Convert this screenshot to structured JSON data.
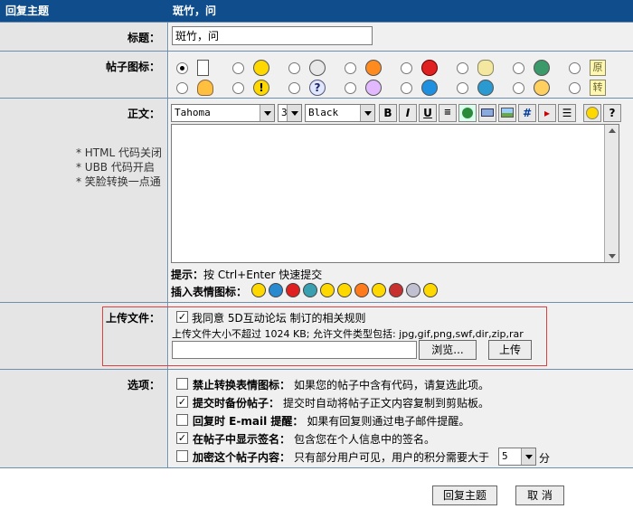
{
  "header": {
    "left": "回复主题",
    "right": "斑竹，问"
  },
  "title_row": {
    "label": "标题：",
    "value": "斑竹，问"
  },
  "post_icon": {
    "label": "帖子图标：",
    "selected_index": 0
  },
  "body_row": {
    "label": "正文：",
    "notes": [
      "* HTML 代码关闭",
      "* UBB 代码开启",
      "* 笑脸转换一点通"
    ],
    "font": "Tahoma",
    "size": "3",
    "color": "Black",
    "hint_label": "提示：",
    "hint_text": "按 Ctrl+Enter 快速提交",
    "insert_label": "插入表情图标："
  },
  "upload": {
    "label": "上传文件：",
    "agree_text": "我同意 5D互动论坛 制订的相关规则",
    "limit_text": "上传文件大小不超过 1024 KB; 允许文件类型包括: jpg,gif,png,swf,dir,zip,rar",
    "browse_label": "浏览...",
    "upload_label": "上传",
    "agree_checked": true
  },
  "options": {
    "label": "选项：",
    "items": [
      {
        "bold": "禁止转换表情图标：",
        "text": "如果您的帖子中含有代码，请复选此项。",
        "checked": false
      },
      {
        "bold": "提交时备份帖子：",
        "text": "提交时自动将帖子正文内容复制到剪贴板。",
        "checked": true
      },
      {
        "bold": "回复时 E-mail 提醒：",
        "text": "如果有回复则通过电子邮件提醒。",
        "checked": false
      },
      {
        "bold": "在帖子中显示签名：",
        "text": "包含您在个人信息中的签名。",
        "checked": true
      },
      {
        "bold": "加密这个帖子内容：",
        "text": "只有部分用户可见，用户的积分需要大于",
        "checked": false
      }
    ],
    "points_value": "5",
    "points_unit": "分"
  },
  "footer": {
    "submit_label": "回复主题",
    "cancel_label": "取 消"
  },
  "icons": {
    "row1": [
      "note-icon",
      "smile-icon",
      "plain-face-icon",
      "orange-face-icon",
      "hand-stop-icon",
      "pointing-hand-icon",
      "green-face-icon",
      "yuan-original-icon"
    ],
    "row2": [
      "lightbulb-icon",
      "exclamation-icon",
      "question-icon",
      "purple-face-icon",
      "blue-face-icon",
      "teal-face-icon",
      "sad-face-icon",
      "zhuan-repost-icon"
    ],
    "yuan_char": "原",
    "zhuan_char": "转",
    "exclaim_char": "!",
    "question_char": "?"
  }
}
